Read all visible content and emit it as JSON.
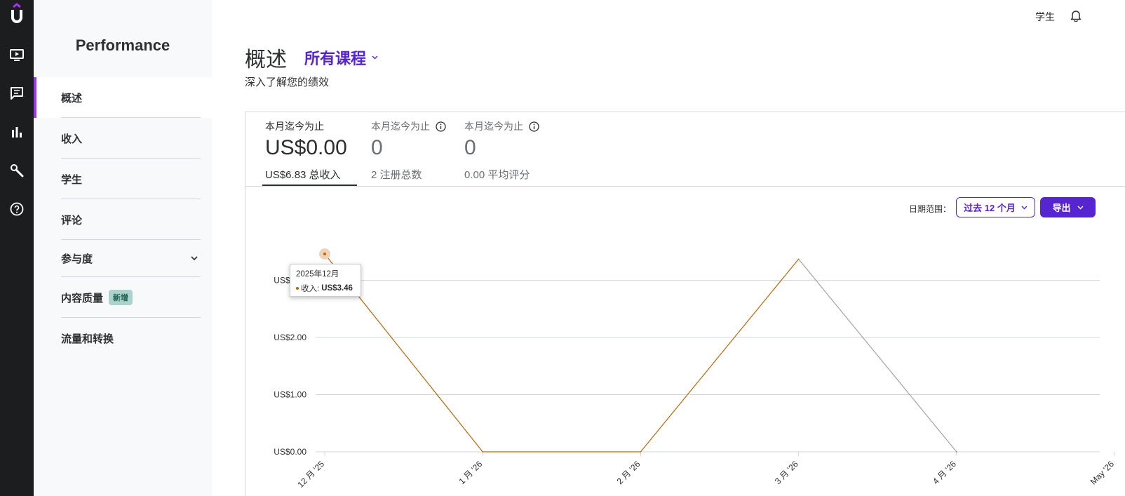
{
  "sidebar": {
    "title": "Performance",
    "items": [
      {
        "label": "概述"
      },
      {
        "label": "收入"
      },
      {
        "label": "学生"
      },
      {
        "label": "评论"
      },
      {
        "label": "参与度"
      },
      {
        "label": "内容质量",
        "badge": "新增"
      },
      {
        "label": "流量和转换"
      }
    ]
  },
  "topbar": {
    "user_label": "学生"
  },
  "header": {
    "title": "概述",
    "course_selector": "所有课程",
    "subtitle": "深入了解您的绩效"
  },
  "metrics": [
    {
      "label": "本月迄今为止",
      "value": "US$0.00",
      "sub": "US$6.83 总收入"
    },
    {
      "label": "本月迄今为止",
      "value": "0",
      "sub": "2 注册总数"
    },
    {
      "label": "本月迄今为止",
      "value": "0",
      "sub": "0.00 平均评分"
    }
  ],
  "controls": {
    "date_range_label": "日期范围：",
    "date_range_value": "过去 12 个月",
    "export_label": "导出"
  },
  "tooltip": {
    "date": "2025年12月",
    "series": "收入:",
    "value": "US$3.46"
  },
  "colors": {
    "accent": "#5624d0",
    "active_bar": "#a435f0",
    "line": "#b4690e",
    "rail": "#1c1d1f"
  },
  "chart_data": {
    "type": "line",
    "x": [
      "12 月 '25",
      "1 月 '26",
      "2 月 '26",
      "3 月 '26",
      "4 月 '26",
      "May '26"
    ],
    "series": [
      {
        "name": "收入",
        "values": [
          3.46,
          0,
          0,
          3.37,
          0,
          null
        ]
      }
    ],
    "y_ticks": [
      "US$0.00",
      "US$1.00",
      "US$2.00",
      "US$3.00"
    ],
    "ylim": [
      0,
      3.6
    ],
    "grid": true
  }
}
